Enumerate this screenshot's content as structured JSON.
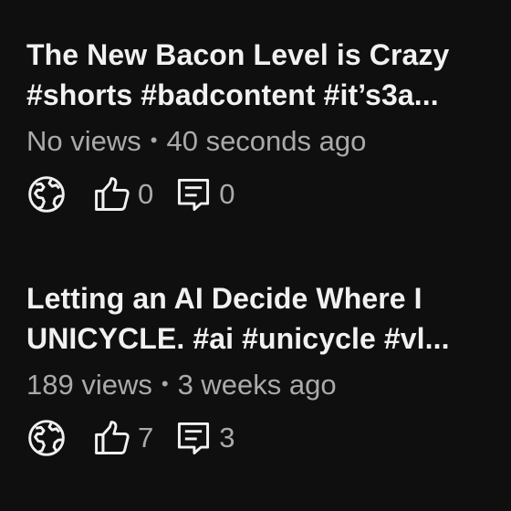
{
  "videos": [
    {
      "title_line1": "The New Bacon Level is Crazy",
      "title_line2": "#shorts #badcontent #it’s3a...",
      "views": "No views",
      "separator": "•",
      "age": "40 seconds ago",
      "visibility_icon": "globe-icon",
      "likes": "0",
      "comments": "0"
    },
    {
      "title_line1": "Letting an AI Decide Where I",
      "title_line2": "UNICYCLE. #ai #unicycle #vl...",
      "views": "189 views",
      "separator": "•",
      "age": "3 weeks ago",
      "visibility_icon": "globe-icon",
      "likes": "7",
      "comments": "3"
    }
  ],
  "colors": {
    "background": "#0f0f0f",
    "title": "#f1f1f1",
    "secondary": "#aaaaaa"
  }
}
